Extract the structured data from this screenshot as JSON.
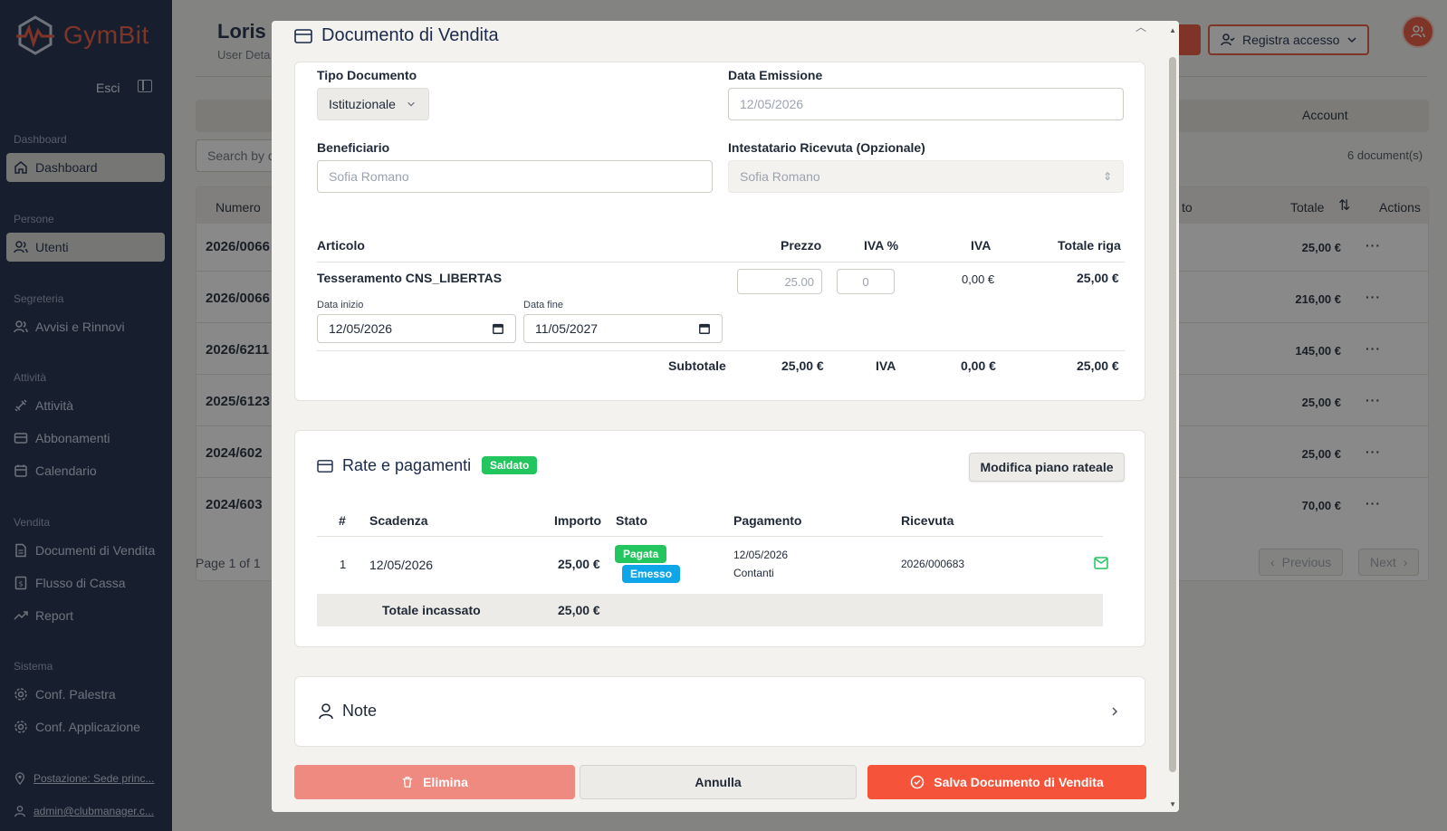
{
  "sidebar": {
    "brand": "GymBit",
    "logout": "Esci",
    "sections": [
      {
        "title": "Dashboard",
        "items": [
          {
            "label": "Dashboard",
            "icon": "home-icon",
            "active": true
          }
        ]
      },
      {
        "title": "Persone",
        "items": [
          {
            "label": "Utenti",
            "icon": "users-icon",
            "active": true
          }
        ]
      },
      {
        "title": "Segreteria",
        "items": [
          {
            "label": "Avvisi e Rinnovi",
            "icon": "users-icon"
          }
        ]
      },
      {
        "title": "Attività",
        "items": [
          {
            "label": "Attività",
            "icon": "dumbbell-icon"
          },
          {
            "label": "Abbonamenti",
            "icon": "card-icon"
          },
          {
            "label": "Calendario",
            "icon": "calendar-icon"
          }
        ]
      },
      {
        "title": "Vendita",
        "items": [
          {
            "label": "Documenti di Vendita",
            "icon": "file-icon"
          },
          {
            "label": "Flusso di Cassa",
            "icon": "receipt-icon"
          },
          {
            "label": "Report",
            "icon": "trending-icon"
          }
        ]
      },
      {
        "title": "Sistema",
        "items": [
          {
            "label": "Conf. Palestra",
            "icon": "gear-icon"
          },
          {
            "label": "Conf. Applicazione",
            "icon": "gear-icon"
          }
        ]
      }
    ],
    "location": "Postazione: Sede princ...",
    "user": "admin@clubmanager.c..."
  },
  "background": {
    "title": "Loris I",
    "subtitle": "User Deta",
    "register_button": "Registra accesso",
    "tab_account": "Account",
    "search_placeholder": "Search by c",
    "documents_count": "6 document(s)",
    "table_headers": {
      "numero": "Numero",
      "to": "to",
      "totale": "Totale",
      "actions": "Actions"
    },
    "rows": [
      {
        "numero": "2026/0066",
        "totale": "25,00 €"
      },
      {
        "numero": "2026/0066",
        "totale": "216,00 €"
      },
      {
        "numero": "2026/6211",
        "totale": "145,00 €"
      },
      {
        "numero": "2025/6123",
        "totale": "25,00 €"
      },
      {
        "numero": "2024/602",
        "totale": "25,00 €"
      },
      {
        "numero": "2024/603",
        "totale": "70,00 €"
      }
    ],
    "pagination": {
      "label": "Page 1 of 1",
      "previous": "Previous",
      "next": "Next"
    }
  },
  "modal": {
    "title": "Documento di Vendita",
    "form": {
      "tipo_documento_label": "Tipo Documento",
      "tipo_documento_value": "Istituzionale",
      "data_emissione_label": "Data Emissione",
      "data_emissione_placeholder": "12/05/2026",
      "beneficiario_label": "Beneficiario",
      "beneficiario_placeholder": "Sofia Romano",
      "intestatario_label": "Intestatario Ricevuta (Opzionale)",
      "intestatario_value": "Sofia Romano"
    },
    "items": {
      "headers": {
        "articolo": "Articolo",
        "prezzo": "Prezzo",
        "iva_pct": "IVA %",
        "iva": "IVA",
        "totale_riga": "Totale riga"
      },
      "row": {
        "articolo": "Tesseramento CNS_LIBERTAS",
        "prezzo": "25.00",
        "iva_pct": "0",
        "iva": "0,00 €",
        "totale_riga": "25,00 €",
        "data_inizio_label": "Data inizio",
        "data_inizio": "12/05/2026",
        "data_fine_label": "Data fine",
        "data_fine": "11/05/2027"
      },
      "subtotal": {
        "label": "Subtotale",
        "prezzo": "25,00 €",
        "iva_label": "IVA",
        "iva": "0,00 €",
        "totale": "25,00 €"
      }
    },
    "payments": {
      "title": "Rate e pagamenti",
      "status_badge": "Saldato",
      "edit_button": "Modifica piano rateale",
      "headers": {
        "num": "#",
        "scadenza": "Scadenza",
        "importo": "Importo",
        "stato": "Stato",
        "pagamento": "Pagamento",
        "ricevuta": "Ricevuta"
      },
      "row": {
        "num": "1",
        "scadenza": "12/05/2026",
        "importo": "25,00 €",
        "stato_pagata": "Pagata",
        "stato_emesso": "Emesso",
        "pagamento_data": "12/05/2026",
        "pagamento_metodo": "Contanti",
        "ricevuta": "2026/000683"
      },
      "total_label": "Totale incassato",
      "total_value": "25,00 €"
    },
    "notes_title": "Note",
    "buttons": {
      "delete": "Elimina",
      "cancel": "Annulla",
      "save": "Salva Documento di Vendita"
    }
  },
  "colors": {
    "brand": "#e8543b",
    "sidebar": "#1b2a4a",
    "success": "#22c55e",
    "info": "#0ea5e9"
  }
}
